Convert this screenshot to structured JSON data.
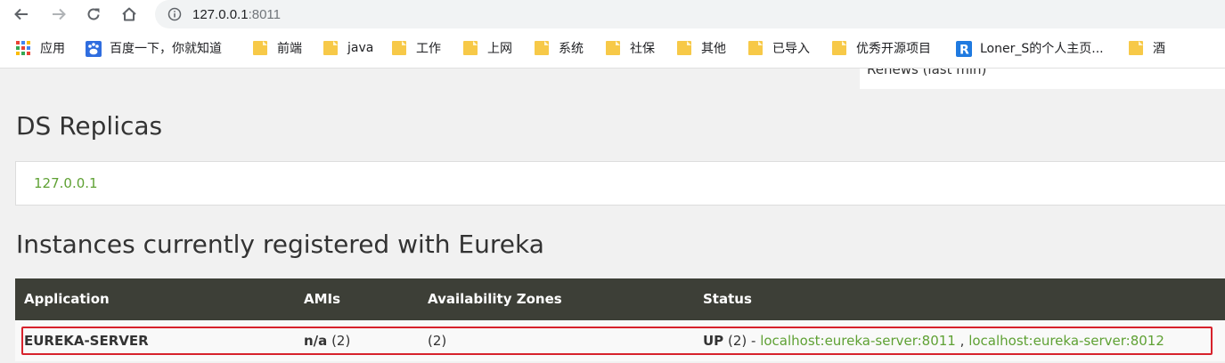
{
  "browser": {
    "url_host": "127.0.0.1",
    "url_port": ":8011",
    "back_icon": "arrow-left-icon",
    "forward_icon": "arrow-right-icon",
    "reload_icon": "reload-icon",
    "home_icon": "home-icon",
    "info_icon": "info-circle-icon"
  },
  "bookmarks": [
    {
      "label": "应用",
      "icon": "apps-grid-icon"
    },
    {
      "label": "百度一下，你就知道",
      "icon": "baidu-icon"
    },
    {
      "label": "前端",
      "icon": "folder-icon"
    },
    {
      "label": "java",
      "icon": "folder-icon"
    },
    {
      "label": "工作",
      "icon": "folder-icon"
    },
    {
      "label": "上网",
      "icon": "folder-icon"
    },
    {
      "label": "系统",
      "icon": "folder-icon"
    },
    {
      "label": "社保",
      "icon": "folder-icon"
    },
    {
      "label": "其他",
      "icon": "folder-icon"
    },
    {
      "label": "已导入",
      "icon": "folder-icon"
    },
    {
      "label": "优秀开源项目",
      "icon": "folder-icon"
    },
    {
      "label": "Loner_S的个人主页...",
      "icon": "r-logo-icon"
    },
    {
      "label": "酒",
      "icon": "folder-icon"
    }
  ],
  "page": {
    "renews_label": "Renews (last min)",
    "replicas_title": "DS Replicas",
    "replica_link": "127.0.0.1",
    "instances_title": "Instances currently registered with Eureka",
    "table": {
      "headers": [
        "Application",
        "AMIs",
        "Availability Zones",
        "Status"
      ],
      "rows": [
        {
          "application": "EUREKA-SERVER",
          "amis_value": "n/a",
          "amis_count": "(2)",
          "zones": "(2)",
          "status": "UP",
          "status_count": "(2) -",
          "instances": [
            "localhost:eureka-server:8011",
            "localhost:eureka-server:8012"
          ],
          "separator": ","
        }
      ]
    }
  },
  "colors": {
    "link_green": "#5fa134",
    "table_header": "#3d3f37",
    "highlight_red": "#d7222c",
    "folder_yellow": "#f7c948"
  }
}
